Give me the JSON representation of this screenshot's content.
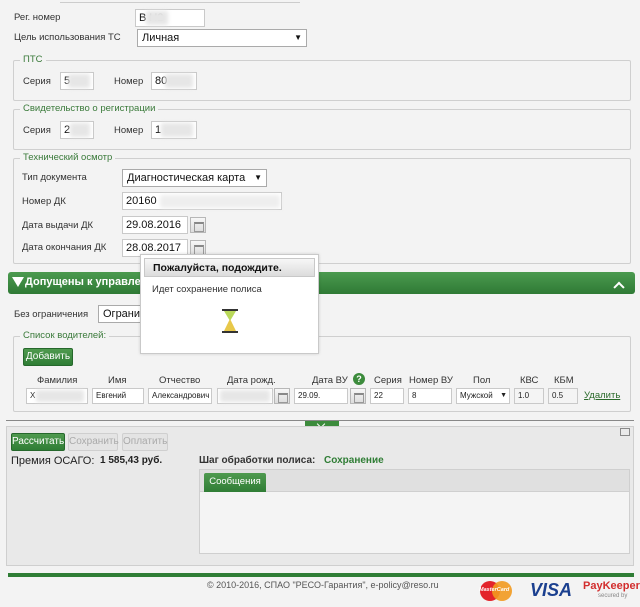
{
  "vehicle": {
    "reg_number_label": "Рег. номер",
    "reg_number_value": "В       Н2",
    "purpose_label": "Цель использования ТС",
    "purpose_value": "Личная"
  },
  "pts": {
    "legend": "ПТС",
    "series_label": "Серия",
    "series_value": "5",
    "number_label": "Номер",
    "number_value": "80"
  },
  "registration": {
    "legend": "Свидетельство о регистрации",
    "series_label": "Серия",
    "series_value": "2",
    "number_label": "Номер",
    "number_value": "1"
  },
  "inspection": {
    "legend": "Технический осмотр",
    "doc_type_label": "Тип документа",
    "doc_type_value": "Диагностическая карта",
    "dk_number_label": "Номер ДК",
    "dk_number_value": "20160",
    "issue_date_label": "Дата выдачи ДК",
    "issue_date_value": "29.08.2016",
    "end_date_label": "Дата окончания ДК",
    "end_date_value": "28.08.2017"
  },
  "drivers_section": {
    "title": "Допущены к управлению",
    "no_limit_label": "Без ограничения",
    "no_limit_value": "Огранич",
    "list_legend": "Список водителей:",
    "add_button": "Добавить",
    "headers": [
      "Фамилия",
      "Имя",
      "Отчество",
      "Дата рожд.",
      "Дата ВУ",
      "Серия",
      "Номер ВУ",
      "Пол",
      "КВС",
      "КБМ"
    ],
    "help_icon_label": "?",
    "driver": {
      "surname": "Х",
      "name": "Евгений",
      "patronymic": "Александрович",
      "birth_date": "",
      "license_date": "29.09.",
      "series": "22",
      "license_number": "8",
      "gender": "Мужской",
      "kvs": "1.0",
      "kbm": "0.5"
    },
    "delete_link": "Удалить"
  },
  "actions": {
    "calculate": "Рассчитать",
    "save": "Сохранить",
    "pay": "Оплатить"
  },
  "premium": {
    "label": "Премия ОСАГО:",
    "value": "1 585,43 руб."
  },
  "processing": {
    "step_label": "Шаг обработки полиса:",
    "step_value": "Сохранение",
    "messages_tab": "Сообщения"
  },
  "modal": {
    "title": "Пожалуйста, подождите.",
    "message": "Идет сохранение полиса"
  },
  "footer": {
    "copyright": "© 2010-2016, СПАО \"РЕСО-Гарантия\", e-policy@reso.ru",
    "mastercard": "MasterCard",
    "visa": "VISA",
    "paykeeper": "PayKeeper",
    "paykeeper_sub": "secured by"
  },
  "colors": {
    "accent_green": "#2f7d35",
    "legend_green": "#3a7a3a",
    "visa_blue": "#1a3f8f",
    "paykeeper_red": "#d22d2d"
  }
}
